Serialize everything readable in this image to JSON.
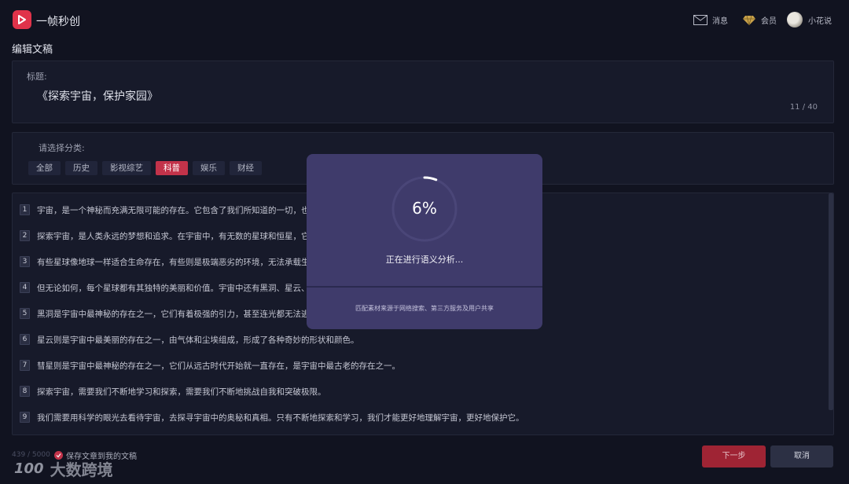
{
  "header": {
    "app_name": "一帧秒创",
    "messages_label": "消息",
    "vip_label": "会员",
    "user_name": "小花说",
    "brand_color": "#e0334a"
  },
  "page_title": "编辑文稿",
  "title_field": {
    "label": "标题:",
    "value": "《探索宇宙，保护家园》",
    "count": "11 / 40"
  },
  "category": {
    "label": "请选择分类:",
    "items": [
      {
        "label": "全部",
        "active": false
      },
      {
        "label": "历史",
        "active": false
      },
      {
        "label": "影视综艺",
        "active": false
      },
      {
        "label": "科普",
        "active": true
      },
      {
        "label": "娱乐",
        "active": false
      },
      {
        "label": "财经",
        "active": false
      }
    ]
  },
  "paragraphs": [
    {
      "num": "1",
      "text": "宇宙，是一个神秘而充满无限可能的存在。它包含了我们所知道的一切，也是"
    },
    {
      "num": "2",
      "text": "探索宇宙，是人类永远的梦想和追求。在宇宙中，有无数的星球和恒星，它们"
    },
    {
      "num": "3",
      "text": "有些星球像地球一样适合生命存在，有些则是极端恶劣的环境，无法承载生命"
    },
    {
      "num": "4",
      "text": "但无论如何，每个星球都有其独特的美丽和价值。宇宙中还有黑洞、星云、彗"
    },
    {
      "num": "5",
      "text": "黑洞是宇宙中最神秘的存在之一，它们有着极强的引力，甚至连光都无法逃脱"
    },
    {
      "num": "6",
      "text": "星云则是宇宙中最美丽的存在之一，由气体和尘埃组成，形成了各种奇妙的形状和颜色。"
    },
    {
      "num": "7",
      "text": "彗星则是宇宙中最神秘的存在之一，它们从远古时代开始就一直存在，是宇宙中最古老的存在之一。"
    },
    {
      "num": "8",
      "text": "探索宇宙，需要我们不断地学习和探索，需要我们不断地挑战自我和突破极限。"
    },
    {
      "num": "9",
      "text": "我们需要用科学的眼光去看待宇宙，去探寻宇宙中的奥秘和真相。只有不断地探索和学习，我们才能更好地理解宇宙，更好地保护它。"
    }
  ],
  "footer": {
    "word_count": "439 / 5000",
    "save_label": "保存文章到我的文稿",
    "next_label": "下一步",
    "cancel_label": "取消",
    "watermark": "大数跨境",
    "watermark_logo": "100"
  },
  "modal": {
    "progress_text": "6%",
    "progress": 0.06,
    "status": "正在进行语义分析...",
    "disclaimer": "匹配素材来源于网络搜索、第三方服务及用户共享"
  }
}
